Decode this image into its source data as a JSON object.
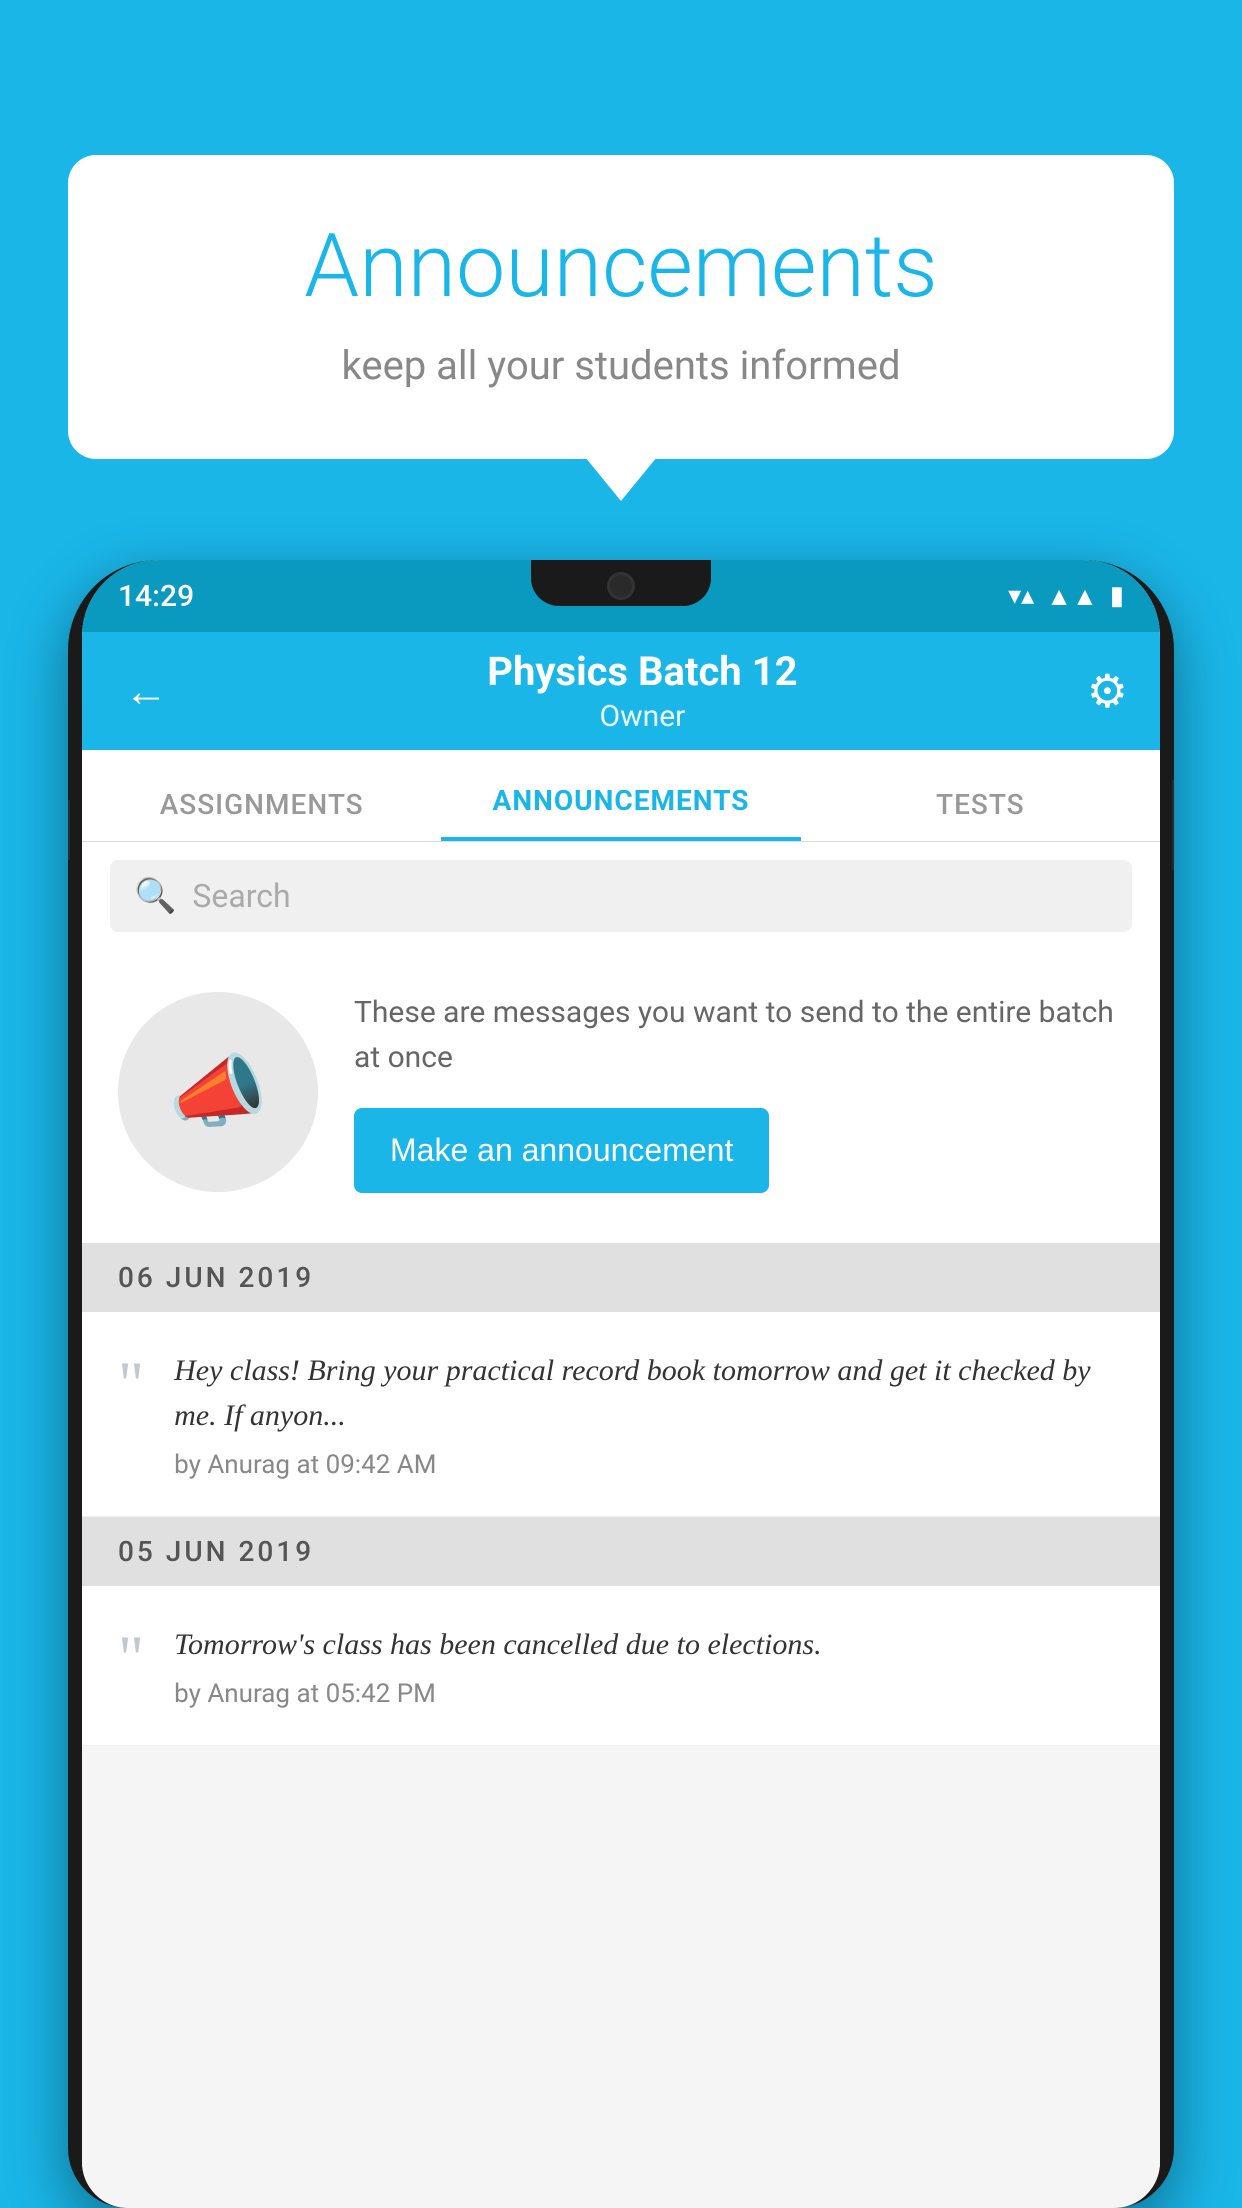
{
  "background_color": "#1ab6e8",
  "speech_bubble": {
    "title": "Announcements",
    "subtitle": "keep all your students informed"
  },
  "status_bar": {
    "time": "14:29",
    "icons": [
      "wifi",
      "signal",
      "battery"
    ]
  },
  "app_bar": {
    "back_label": "←",
    "title": "Physics Batch 12",
    "subtitle": "Owner",
    "settings_icon": "⚙"
  },
  "tabs": [
    {
      "label": "ASSIGNMENTS",
      "active": false
    },
    {
      "label": "ANNOUNCEMENTS",
      "active": true
    },
    {
      "label": "TESTS",
      "active": false
    }
  ],
  "search": {
    "placeholder": "Search"
  },
  "announcement_prompt": {
    "description": "These are messages you want to send to the entire batch at once",
    "button_label": "Make an announcement"
  },
  "date_sections": [
    {
      "date": "06  JUN  2019",
      "items": [
        {
          "text": "Hey class! Bring your practical record book tomorrow and get it checked by me. If anyon...",
          "meta": "by Anurag at 09:42 AM"
        }
      ]
    },
    {
      "date": "05  JUN  2019",
      "items": [
        {
          "text": "Tomorrow's class has been cancelled due to elections.",
          "meta": "by Anurag at 05:42 PM"
        }
      ]
    }
  ]
}
